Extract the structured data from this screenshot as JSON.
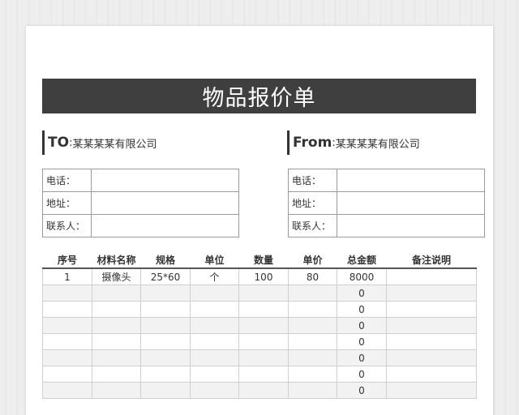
{
  "document": {
    "title": "物品报价单",
    "to": {
      "tag": "TO",
      "colon": ":",
      "company": "某某某某有限公司"
    },
    "from": {
      "tag": "From",
      "colon": ":",
      "company": "某某某某有限公司"
    },
    "contact_labels": [
      "电话：",
      "地址：",
      "联系人："
    ]
  },
  "items_table": {
    "headers": [
      "序号",
      "材料名称",
      "规格",
      "单位",
      "数量",
      "单价",
      "总金额",
      "备注说明"
    ],
    "rows": [
      [
        "1",
        "摄像头",
        "25*60",
        "个",
        "100",
        "80",
        "8000",
        ""
      ],
      [
        "",
        "",
        "",
        "",
        "",
        "",
        "0",
        ""
      ],
      [
        "",
        "",
        "",
        "",
        "",
        "",
        "0",
        ""
      ],
      [
        "",
        "",
        "",
        "",
        "",
        "",
        "0",
        ""
      ],
      [
        "",
        "",
        "",
        "",
        "",
        "",
        "0",
        ""
      ],
      [
        "",
        "",
        "",
        "",
        "",
        "",
        "0",
        ""
      ],
      [
        "",
        "",
        "",
        "",
        "",
        "",
        "0",
        ""
      ],
      [
        "",
        "",
        "",
        "",
        "",
        "",
        "0",
        ""
      ]
    ]
  }
}
